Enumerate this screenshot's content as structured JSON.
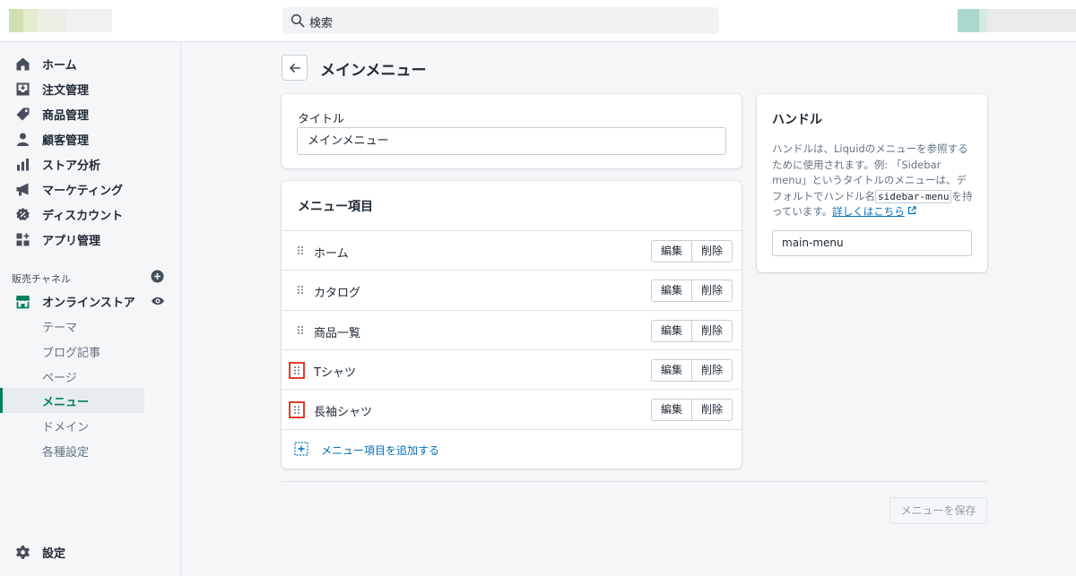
{
  "search": {
    "placeholder": "検索"
  },
  "sidebar": {
    "items": [
      {
        "label": "ホーム",
        "icon": "home-icon"
      },
      {
        "label": "注文管理",
        "icon": "orders-icon"
      },
      {
        "label": "商品管理",
        "icon": "tag-icon"
      },
      {
        "label": "顧客管理",
        "icon": "person-icon"
      },
      {
        "label": "ストア分析",
        "icon": "bar-chart-icon"
      },
      {
        "label": "マーケティング",
        "icon": "megaphone-icon"
      },
      {
        "label": "ディスカウント",
        "icon": "discount-icon"
      },
      {
        "label": "アプリ管理",
        "icon": "apps-icon"
      }
    ],
    "channels_label": "販売チャネル",
    "online_store": {
      "label": "オンラインストア",
      "icon": "store-icon"
    },
    "sub_items": [
      "テーマ",
      "ブログ記事",
      "ページ",
      "メニュー",
      "ドメイン",
      "各種設定"
    ],
    "active_sub": "メニュー",
    "settings": {
      "label": "設定",
      "icon": "gear-icon"
    }
  },
  "page": {
    "title": "メインメニュー"
  },
  "title_card": {
    "label": "タイトル",
    "value": "メインメニュー"
  },
  "menu_card": {
    "heading": "メニュー項目",
    "rows": [
      {
        "name": "ホーム",
        "highlighted": false
      },
      {
        "name": "カタログ",
        "highlighted": false
      },
      {
        "name": "商品一覧",
        "highlighted": false
      },
      {
        "name": "Tシャツ",
        "highlighted": true
      },
      {
        "name": "長袖シャツ",
        "highlighted": true
      }
    ],
    "edit_label": "編集",
    "delete_label": "削除",
    "add_label": "メニュー項目を追加する"
  },
  "handle_card": {
    "heading": "ハンドル",
    "desc_1": "ハンドルは、Liquidのメニューを参照するために使用されます。例: 「Sidebar menu」というタイトルのメニューは、デフォルトでハンドル名",
    "desc_code": "sidebar-menu",
    "desc_2": "を持っています。",
    "link": "詳しくはこちら",
    "value": "main-menu"
  },
  "save_label": "メニューを保存",
  "colors": {
    "accent": "#008060",
    "link": "#006fbb",
    "highlight": "#e33b2b"
  }
}
